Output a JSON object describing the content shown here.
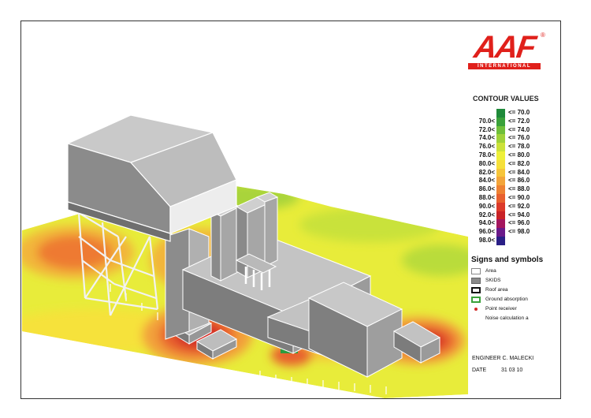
{
  "logo": {
    "main": "AAF",
    "sub": "INTERNATIONAL",
    "reg": "®"
  },
  "legend": {
    "title": "CONTOUR VALUES",
    "rows": [
      {
        "lo": "",
        "hi": "<= 70.0",
        "color": "#1f8a3a"
      },
      {
        "lo": "70.0<",
        "hi": "<= 72.0",
        "color": "#3aa13a"
      },
      {
        "lo": "72.0<",
        "hi": "<= 74.0",
        "color": "#6fbf3a"
      },
      {
        "lo": "74.0<",
        "hi": "<= 76.0",
        "color": "#9fd23a"
      },
      {
        "lo": "76.0<",
        "hi": "<= 78.0",
        "color": "#cce23a"
      },
      {
        "lo": "78.0<",
        "hi": "<= 80.0",
        "color": "#eef03a"
      },
      {
        "lo": "80.0<",
        "hi": "<= 82.0",
        "color": "#f6e03a"
      },
      {
        "lo": "82.0<",
        "hi": "<= 84.0",
        "color": "#f6c53a"
      },
      {
        "lo": "84.0<",
        "hi": "<= 86.0",
        "color": "#f3a53a"
      },
      {
        "lo": "86.0<",
        "hi": "<= 88.0",
        "color": "#ee8233"
      },
      {
        "lo": "88.0<",
        "hi": "<= 90.0",
        "color": "#e8602e"
      },
      {
        "lo": "90.0<",
        "hi": "<= 92.0",
        "color": "#dc3a2a"
      },
      {
        "lo": "92.0<",
        "hi": "<= 94.0",
        "color": "#c92226"
      },
      {
        "lo": "94.0<",
        "hi": "<= 96.0",
        "color": "#a4165e"
      },
      {
        "lo": "96.0<",
        "hi": "<= 98.0",
        "color": "#6a1a8a"
      },
      {
        "lo": "98.0<",
        "hi": "",
        "color": "#2a1f86"
      }
    ]
  },
  "signs": {
    "title": "Signs and symbols",
    "items": [
      {
        "label": "Area",
        "kind": "area"
      },
      {
        "label": "SKIDS",
        "kind": "skids"
      },
      {
        "label": "Roof area",
        "kind": "roof"
      },
      {
        "label": "Ground absorption",
        "kind": "ground"
      },
      {
        "label": "Point receiver",
        "kind": "point"
      },
      {
        "label": "Noise calculation a",
        "kind": "none"
      }
    ]
  },
  "footer": {
    "engineer": "ENGINEER  C. MALECKI",
    "date_label": "DATE",
    "date_value": "31 03 10"
  }
}
